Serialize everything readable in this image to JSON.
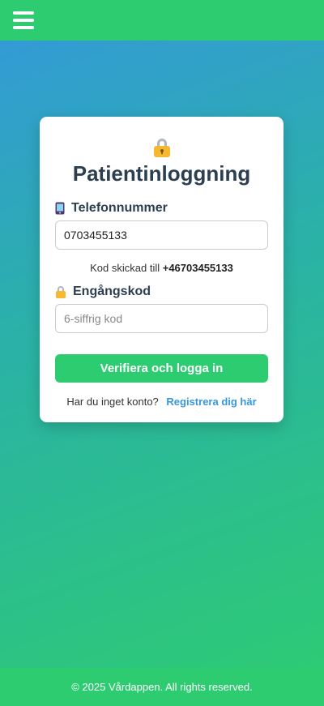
{
  "header": {
    "menu_icon": "hamburger-menu-icon"
  },
  "login": {
    "lock_icon": "lock-icon",
    "title": "Patientinloggning",
    "phone": {
      "icon": "mobile-phone-icon",
      "label": "Telefonnummer",
      "value": "0703455133"
    },
    "code_sent_prefix": "Kod skickad till",
    "code_sent_number": "+46703455133",
    "otp": {
      "icon": "lock-icon",
      "label": "Engångskod",
      "placeholder": "6-siffrig kod"
    },
    "submit_label": "Verifiera och logga in",
    "register_prompt": "Har du inget konto?",
    "register_link": "Registrera dig här"
  },
  "footer": {
    "text": "© 2025 Vårdappen. All rights reserved."
  },
  "colors": {
    "primary_green": "#2ecc71",
    "link_blue": "#3498db",
    "title": "#2c3e50"
  }
}
